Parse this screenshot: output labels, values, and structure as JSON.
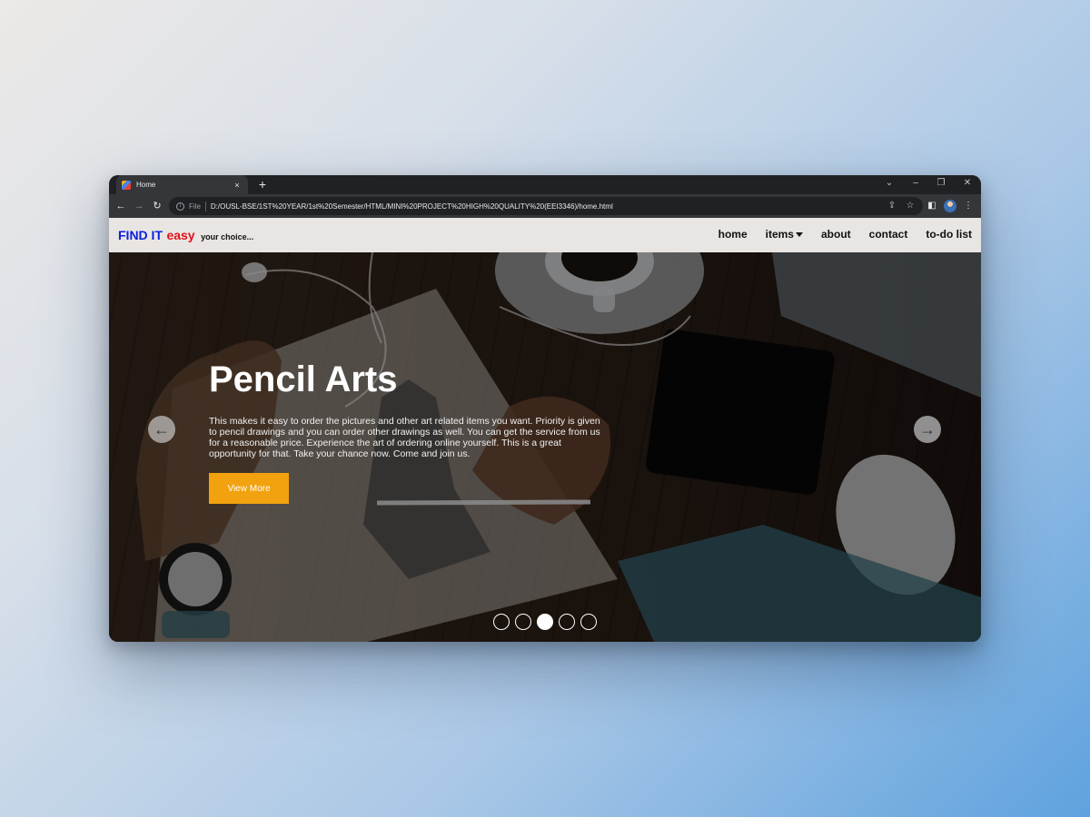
{
  "browser": {
    "tab_title": "Home",
    "tab_close": "×",
    "new_tab": "+",
    "file_label": "File",
    "url": "D:/OUSL-BSE/1ST%20YEAR/1st%20Semester/HTML/MINI%20PROJECT%20HIGH%20QUALITY%20(EEI3346)/home.html"
  },
  "site": {
    "logo_main": "FIND IT",
    "logo_accent": "easy",
    "logo_tagline": "your choice...",
    "nav": {
      "home": "home",
      "items": "items",
      "about": "about",
      "contact": "contact",
      "todo": "to-do list"
    }
  },
  "hero": {
    "title": "Pencil Arts",
    "description": "This makes it easy to order the pictures and other art related items you want. Priority is given to pencil drawings and you can order other drawings as well. You can get the service from us for a reasonable price. Experience the art of ordering online yourself. This is a great opportunity for that. Take your chance now. Come and join us.",
    "button_label": "View More",
    "slide_count": 5,
    "active_slide": 3
  },
  "colors": {
    "logo_blue": "#0b1fe0",
    "logo_red": "#e30f1a",
    "button_orange": "#f2a20f"
  }
}
